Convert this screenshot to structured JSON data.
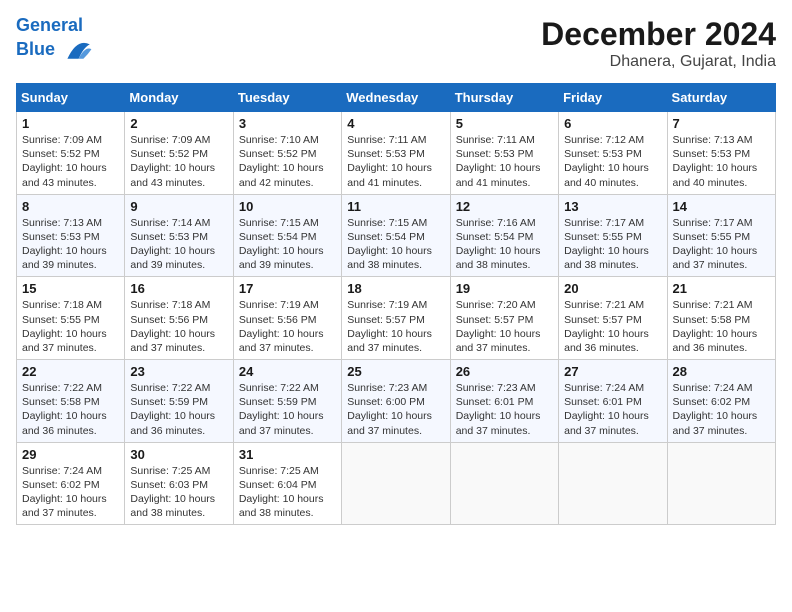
{
  "header": {
    "logo_line1": "General",
    "logo_line2": "Blue",
    "month": "December 2024",
    "location": "Dhanera, Gujarat, India"
  },
  "days_of_week": [
    "Sunday",
    "Monday",
    "Tuesday",
    "Wednesday",
    "Thursday",
    "Friday",
    "Saturday"
  ],
  "weeks": [
    [
      {
        "num": "1",
        "rise": "7:09 AM",
        "set": "5:52 PM",
        "daylight": "10 hours and 43 minutes."
      },
      {
        "num": "2",
        "rise": "7:09 AM",
        "set": "5:52 PM",
        "daylight": "10 hours and 43 minutes."
      },
      {
        "num": "3",
        "rise": "7:10 AM",
        "set": "5:52 PM",
        "daylight": "10 hours and 42 minutes."
      },
      {
        "num": "4",
        "rise": "7:11 AM",
        "set": "5:53 PM",
        "daylight": "10 hours and 41 minutes."
      },
      {
        "num": "5",
        "rise": "7:11 AM",
        "set": "5:53 PM",
        "daylight": "10 hours and 41 minutes."
      },
      {
        "num": "6",
        "rise": "7:12 AM",
        "set": "5:53 PM",
        "daylight": "10 hours and 40 minutes."
      },
      {
        "num": "7",
        "rise": "7:13 AM",
        "set": "5:53 PM",
        "daylight": "10 hours and 40 minutes."
      }
    ],
    [
      {
        "num": "8",
        "rise": "7:13 AM",
        "set": "5:53 PM",
        "daylight": "10 hours and 39 minutes."
      },
      {
        "num": "9",
        "rise": "7:14 AM",
        "set": "5:53 PM",
        "daylight": "10 hours and 39 minutes."
      },
      {
        "num": "10",
        "rise": "7:15 AM",
        "set": "5:54 PM",
        "daylight": "10 hours and 39 minutes."
      },
      {
        "num": "11",
        "rise": "7:15 AM",
        "set": "5:54 PM",
        "daylight": "10 hours and 38 minutes."
      },
      {
        "num": "12",
        "rise": "7:16 AM",
        "set": "5:54 PM",
        "daylight": "10 hours and 38 minutes."
      },
      {
        "num": "13",
        "rise": "7:17 AM",
        "set": "5:55 PM",
        "daylight": "10 hours and 38 minutes."
      },
      {
        "num": "14",
        "rise": "7:17 AM",
        "set": "5:55 PM",
        "daylight": "10 hours and 37 minutes."
      }
    ],
    [
      {
        "num": "15",
        "rise": "7:18 AM",
        "set": "5:55 PM",
        "daylight": "10 hours and 37 minutes."
      },
      {
        "num": "16",
        "rise": "7:18 AM",
        "set": "5:56 PM",
        "daylight": "10 hours and 37 minutes."
      },
      {
        "num": "17",
        "rise": "7:19 AM",
        "set": "5:56 PM",
        "daylight": "10 hours and 37 minutes."
      },
      {
        "num": "18",
        "rise": "7:19 AM",
        "set": "5:57 PM",
        "daylight": "10 hours and 37 minutes."
      },
      {
        "num": "19",
        "rise": "7:20 AM",
        "set": "5:57 PM",
        "daylight": "10 hours and 37 minutes."
      },
      {
        "num": "20",
        "rise": "7:21 AM",
        "set": "5:57 PM",
        "daylight": "10 hours and 36 minutes."
      },
      {
        "num": "21",
        "rise": "7:21 AM",
        "set": "5:58 PM",
        "daylight": "10 hours and 36 minutes."
      }
    ],
    [
      {
        "num": "22",
        "rise": "7:22 AM",
        "set": "5:58 PM",
        "daylight": "10 hours and 36 minutes."
      },
      {
        "num": "23",
        "rise": "7:22 AM",
        "set": "5:59 PM",
        "daylight": "10 hours and 36 minutes."
      },
      {
        "num": "24",
        "rise": "7:22 AM",
        "set": "5:59 PM",
        "daylight": "10 hours and 37 minutes."
      },
      {
        "num": "25",
        "rise": "7:23 AM",
        "set": "6:00 PM",
        "daylight": "10 hours and 37 minutes."
      },
      {
        "num": "26",
        "rise": "7:23 AM",
        "set": "6:01 PM",
        "daylight": "10 hours and 37 minutes."
      },
      {
        "num": "27",
        "rise": "7:24 AM",
        "set": "6:01 PM",
        "daylight": "10 hours and 37 minutes."
      },
      {
        "num": "28",
        "rise": "7:24 AM",
        "set": "6:02 PM",
        "daylight": "10 hours and 37 minutes."
      }
    ],
    [
      {
        "num": "29",
        "rise": "7:24 AM",
        "set": "6:02 PM",
        "daylight": "10 hours and 37 minutes."
      },
      {
        "num": "30",
        "rise": "7:25 AM",
        "set": "6:03 PM",
        "daylight": "10 hours and 38 minutes."
      },
      {
        "num": "31",
        "rise": "7:25 AM",
        "set": "6:04 PM",
        "daylight": "10 hours and 38 minutes."
      },
      null,
      null,
      null,
      null
    ]
  ]
}
